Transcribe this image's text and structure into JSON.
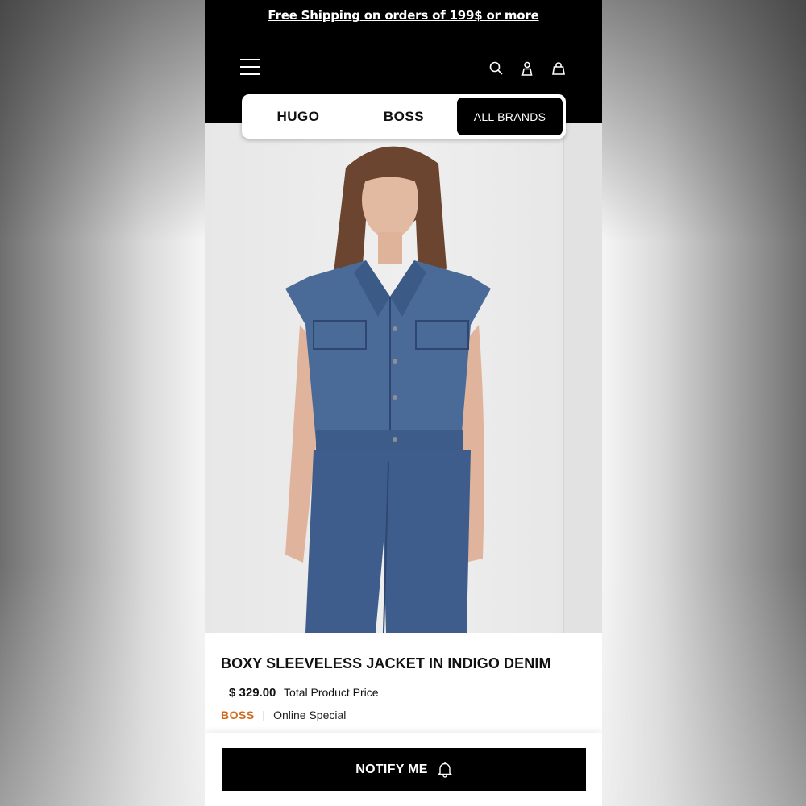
{
  "promo": {
    "text": "Free Shipping on orders of 199$  or more"
  },
  "header": {
    "menu_icon": "hamburger-menu-icon",
    "search_icon": "search-icon",
    "account_icon": "user-icon",
    "bag_icon": "shopping-bag-icon"
  },
  "brands": {
    "tabs": [
      {
        "label": "HUGO"
      },
      {
        "label": "BOSS"
      },
      {
        "label": "ALL BRANDS",
        "active": true
      }
    ]
  },
  "product": {
    "title": "BOXY SLEEVELESS JACKET IN INDIGO DENIM",
    "price": "$ 329.00",
    "price_label": "Total Product Price",
    "brand": "BOSS",
    "separator": "|",
    "tag": "Online Special",
    "brand_color": "#d2691e"
  },
  "cta": {
    "label": "NOTIFY ME",
    "icon": "bell-icon"
  }
}
